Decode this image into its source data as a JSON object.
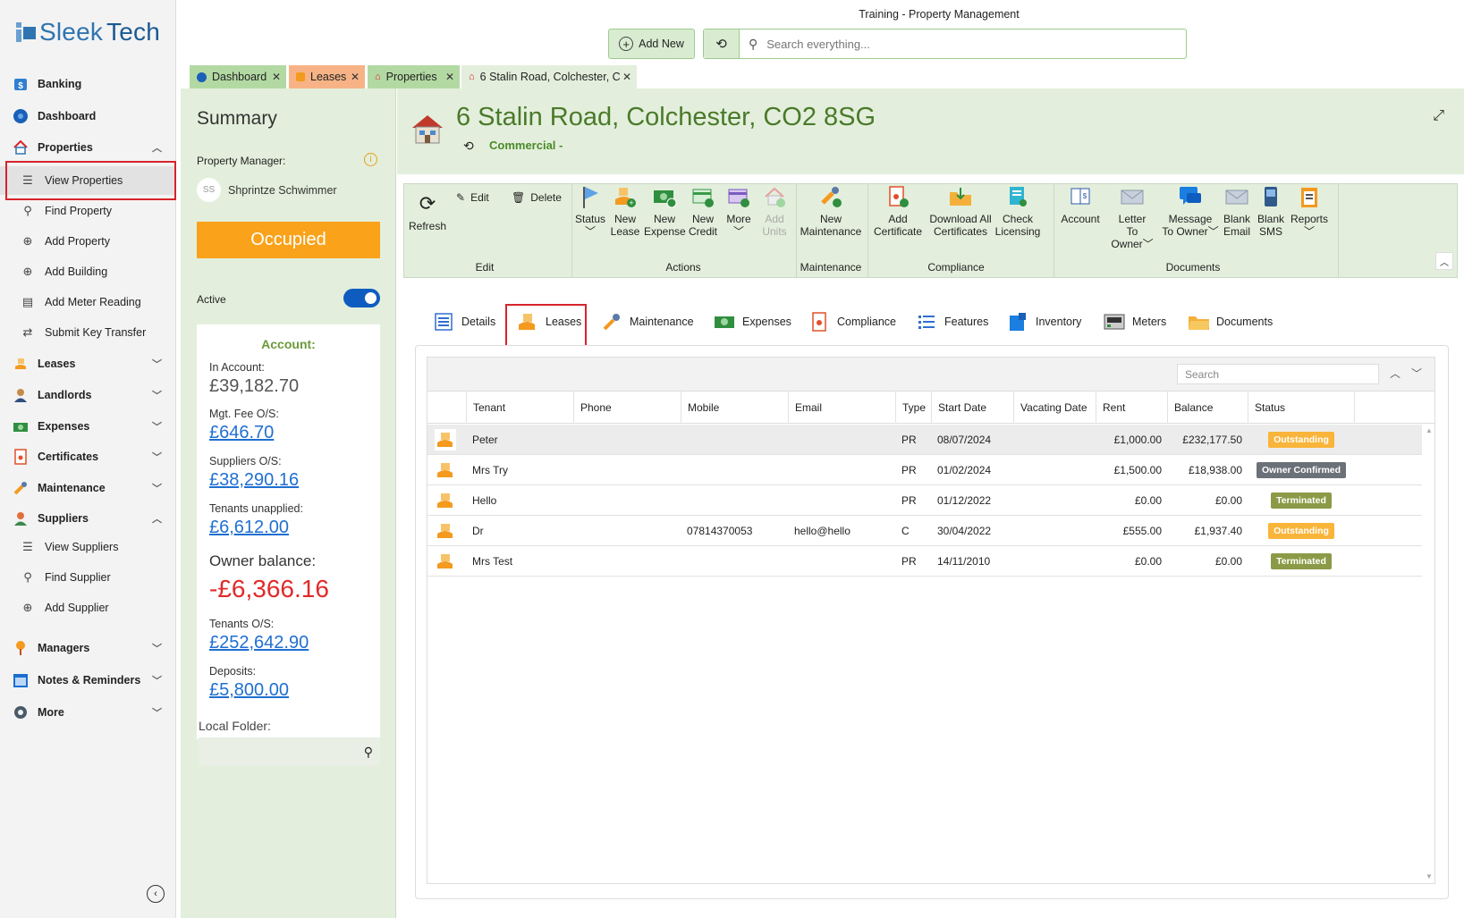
{
  "app": {
    "window_title": "Training - Property Management",
    "logo_text_1": "Sleek",
    "logo_text_2": "Tech"
  },
  "top": {
    "add_new_label": "Add New",
    "search_placeholder": "Search everything..."
  },
  "window_tabs": [
    {
      "label": "Dashboard",
      "color": "#b3d9a3"
    },
    {
      "label": "Leases",
      "color": "#f7b386"
    },
    {
      "label": "Properties",
      "color": "#b3d9a3"
    },
    {
      "label": "6 Stalin Road, Colchester, C",
      "color": "#e3efdc"
    }
  ],
  "sidebar": {
    "items": [
      {
        "label": "Banking",
        "icon": "bank-icon"
      },
      {
        "label": "Dashboard",
        "icon": "dashboard-icon"
      },
      {
        "label": "Properties",
        "icon": "home-icon",
        "expanded": true
      },
      {
        "label": "Leases",
        "icon": "lease-icon"
      },
      {
        "label": "Landlords",
        "icon": "person-icon"
      },
      {
        "label": "Expenses",
        "icon": "money-icon"
      },
      {
        "label": "Certificates",
        "icon": "certificate-icon"
      },
      {
        "label": "Maintenance",
        "icon": "wrench-icon"
      },
      {
        "label": "Suppliers",
        "icon": "worker-icon",
        "expanded": true
      },
      {
        "label": "Managers",
        "icon": "manager-icon"
      },
      {
        "label": "Notes & Reminders",
        "icon": "calendar-icon"
      },
      {
        "label": "More",
        "icon": "gear-icon"
      }
    ],
    "properties_sub": [
      "View Properties",
      "Find Property",
      "Add Property",
      "Add Building",
      "Add Meter Reading",
      "Submit Key Transfer"
    ],
    "suppliers_sub": [
      "View Suppliers",
      "Find Supplier",
      "Add Supplier"
    ]
  },
  "summary": {
    "title": "Summary",
    "pm_label": "Property Manager:",
    "pm_initials": "SS",
    "pm_name": "Shprintze Schwimmer",
    "status": "Occupied",
    "active_label": "Active",
    "active": true,
    "account_heading": "Account:",
    "in_account_label": "In Account:",
    "in_account": "£39,182.70",
    "mgt_fee_label": "Mgt. Fee O/S:",
    "mgt_fee": "£646.70",
    "suppliers_label": "Suppliers O/S:",
    "suppliers": "£38,290.16",
    "tenants_unapplied_label": "Tenants unapplied:",
    "tenants_unapplied": "£6,612.00",
    "owner_balance_label": "Owner balance:",
    "owner_balance": "-£6,366.16",
    "tenants_os_label": "Tenants O/S:",
    "tenants_os": "£252,642.90",
    "deposits_label": "Deposits:",
    "deposits": "£5,800.00",
    "local_folder_label": "Local Folder:"
  },
  "property": {
    "title": "6 Stalin Road, Colchester, CO2 8SG",
    "type": "Commercial -"
  },
  "ribbon": {
    "refresh": "Refresh",
    "edit": "Edit",
    "delete": "Delete",
    "groups": [
      "Edit",
      "Actions",
      "Maintenance",
      "Compliance",
      "Documents"
    ],
    "actions": [
      [
        "Status",
        ""
      ],
      [
        "New",
        "Lease"
      ],
      [
        "New",
        "Expense"
      ],
      [
        "New",
        "Credit"
      ],
      [
        "More",
        ""
      ],
      [
        "Add",
        "Units"
      ]
    ],
    "maintenance": [
      [
        "New",
        "Maintenance"
      ]
    ],
    "compliance": [
      [
        "Add",
        "Certificate"
      ],
      [
        "Download All",
        "Certificates"
      ],
      [
        "Check",
        "Licensing"
      ]
    ],
    "documents": [
      [
        "Account",
        ""
      ],
      [
        "Letter",
        "To Owner"
      ],
      [
        "Message",
        "To Owner"
      ],
      [
        "Blank",
        "Email"
      ],
      [
        "Blank",
        "SMS"
      ],
      [
        "Reports",
        ""
      ]
    ]
  },
  "content_tabs": [
    "Details",
    "Leases",
    "Maintenance",
    "Expenses",
    "Compliance",
    "Features",
    "Inventory",
    "Meters",
    "Documents"
  ],
  "grid": {
    "search_placeholder": "Search",
    "columns": [
      "Tenant",
      "Phone",
      "Mobile",
      "Email",
      "Type",
      "Start Date",
      "Vacating Date",
      "Rent",
      "Balance",
      "Status"
    ],
    "rows": [
      {
        "tenant": "Peter",
        "phone": "",
        "mobile": "",
        "email": "",
        "type": "PR",
        "start": "08/07/2024",
        "vacating": "",
        "rent": "£1,000.00",
        "balance": "£232,177.50",
        "status": "Outstanding",
        "status_color": "#f9b43a"
      },
      {
        "tenant": "Mrs Try",
        "phone": "",
        "mobile": "",
        "email": "",
        "type": "PR",
        "start": "01/02/2024",
        "vacating": "",
        "rent": "£1,500.00",
        "balance": "£18,938.00",
        "status": "Owner Confirmed",
        "status_color": "#6b7179"
      },
      {
        "tenant": "Hello",
        "phone": "",
        "mobile": "",
        "email": "",
        "type": "PR",
        "start": "01/12/2022",
        "vacating": "",
        "rent": "£0.00",
        "balance": "£0.00",
        "status": "Terminated",
        "status_color": "#8b9a46"
      },
      {
        "tenant": "Dr",
        "phone": "",
        "mobile": "07814370053",
        "email": "hello@hello",
        "type": "C",
        "start": "30/04/2022",
        "vacating": "",
        "rent": "£555.00",
        "balance": "£1,937.40",
        "status": "Outstanding",
        "status_color": "#f9b43a"
      },
      {
        "tenant": "Mrs Test",
        "phone": "",
        "mobile": "",
        "email": "",
        "type": "PR",
        "start": "14/11/2010",
        "vacating": "",
        "rent": "£0.00",
        "balance": "£0.00",
        "status": "Terminated",
        "status_color": "#8b9a46"
      }
    ]
  }
}
